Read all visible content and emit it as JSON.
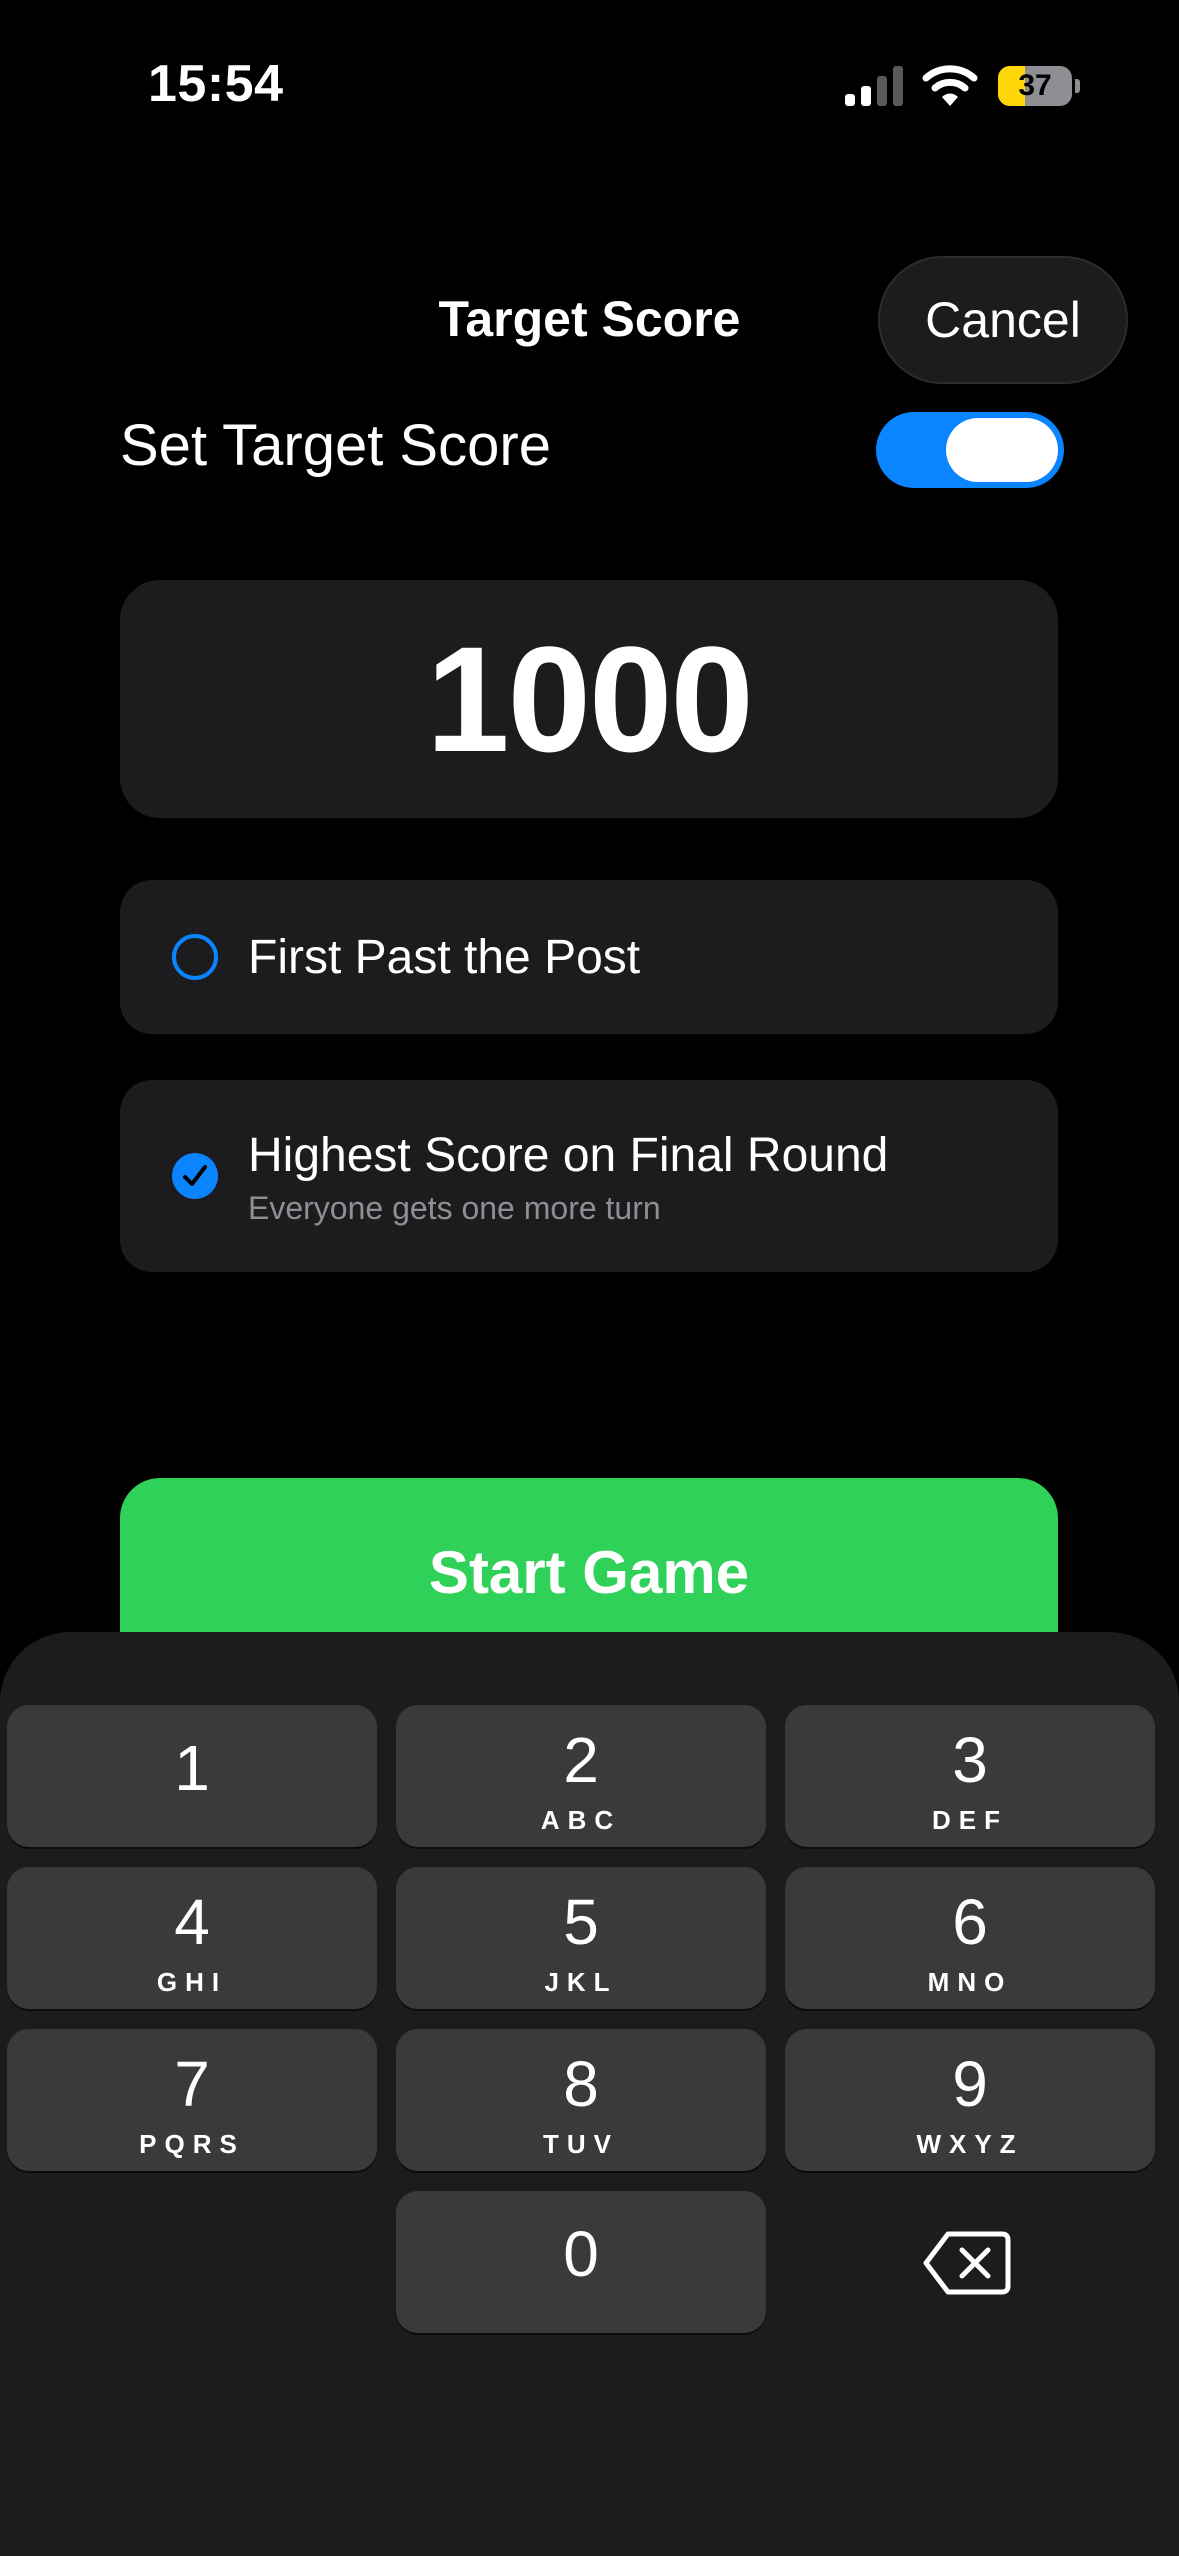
{
  "status_bar": {
    "time": "15:54",
    "battery_percent": "37",
    "battery_level": 0.37,
    "icons": [
      "signal-icon",
      "wifi-icon",
      "battery-icon"
    ]
  },
  "header": {
    "title": "Target Score",
    "cancel_label": "Cancel"
  },
  "toggle": {
    "label": "Set Target Score",
    "on": true
  },
  "score": {
    "value": "1000"
  },
  "options": {
    "first_past_post": {
      "title": "First Past the Post",
      "selected": false
    },
    "highest_score": {
      "title": "Highest Score on Final Round",
      "subtitle": "Everyone gets one more turn",
      "selected": true
    }
  },
  "start_button": {
    "label": "Start Game"
  },
  "keyboard": {
    "keys": [
      {
        "digit": "1",
        "letters": ""
      },
      {
        "digit": "2",
        "letters": "ABC"
      },
      {
        "digit": "3",
        "letters": "DEF"
      },
      {
        "digit": "4",
        "letters": "GHI"
      },
      {
        "digit": "5",
        "letters": "JKL"
      },
      {
        "digit": "6",
        "letters": "MNO"
      },
      {
        "digit": "7",
        "letters": "PQRS"
      },
      {
        "digit": "8",
        "letters": "TUV"
      },
      {
        "digit": "9",
        "letters": "WXYZ"
      },
      {
        "digit": "0",
        "letters": ""
      }
    ],
    "delete_icon": "delete-backward-icon"
  },
  "colors": {
    "accent": "#0a84ff",
    "start_green": "#30d158",
    "card_bg": "#1c1c1e",
    "key_bg": "#3a3a3c",
    "battery_yellow": "#ffd60a"
  }
}
